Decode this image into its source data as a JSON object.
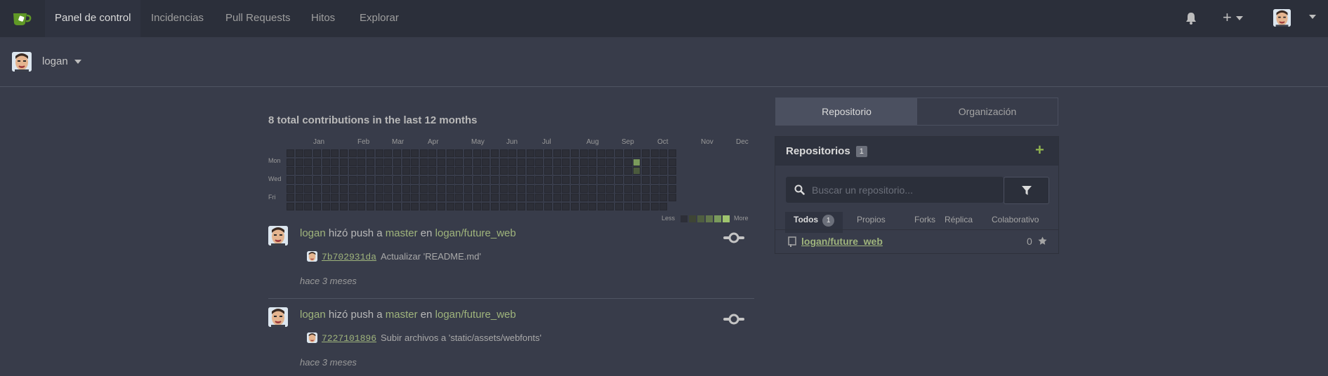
{
  "nav": {
    "items": [
      "Panel de control",
      "Incidencias",
      "Pull Requests",
      "Hitos",
      "Explorar"
    ],
    "plus_label": "+",
    "bell_icon": "bell-icon",
    "logo_icon": "gitea-teacup-icon"
  },
  "context": {
    "user": "logan"
  },
  "heatmap": {
    "title": "8 total contributions in the last 12 months",
    "months": [
      "Jan",
      "Feb",
      "Mar",
      "Apr",
      "May",
      "Jun",
      "Jul",
      "Aug",
      "Sep",
      "Oct",
      "Nov",
      "Dec"
    ],
    "days": [
      "Mon",
      "Wed",
      "Fri"
    ],
    "legend_less": "Less",
    "legend_more": "More",
    "active_week": 39,
    "active_days": [
      {
        "day": 1,
        "level": 2
      },
      {
        "day": 2,
        "level": 1
      }
    ]
  },
  "feed": [
    {
      "user": "logan",
      "action": "hizó push a",
      "branch": "master",
      "connector": "en",
      "repo": "logan/future_web",
      "sha": "7b702931da",
      "message": "Actualizar 'README.md'",
      "time": "hace 3 meses"
    },
    {
      "user": "logan",
      "action": "hizó push a",
      "branch": "master",
      "connector": "en",
      "repo": "logan/future_web",
      "sha": "7227101896",
      "message": "Subir archivos a 'static/assets/webfonts'",
      "time": "hace 3 meses"
    }
  ],
  "panel": {
    "tabs": [
      "Repositorio",
      "Organización"
    ],
    "active_tab": "Repositorio",
    "title": "Repositorios",
    "count": "1",
    "add_label": "+",
    "search_placeholder": "Buscar un repositorio...",
    "filters": [
      "Todos",
      "Propios",
      "Forks",
      "Réplica",
      "Colaborativo"
    ],
    "filters_count": "1",
    "repos": [
      {
        "name": "logan/future_web",
        "stars": "0"
      }
    ]
  },
  "colors": {
    "accent_green": "#9fb47c",
    "add_green": "#8fb14f",
    "background": "#383c4a",
    "nav_bg": "#2b2f3a"
  }
}
